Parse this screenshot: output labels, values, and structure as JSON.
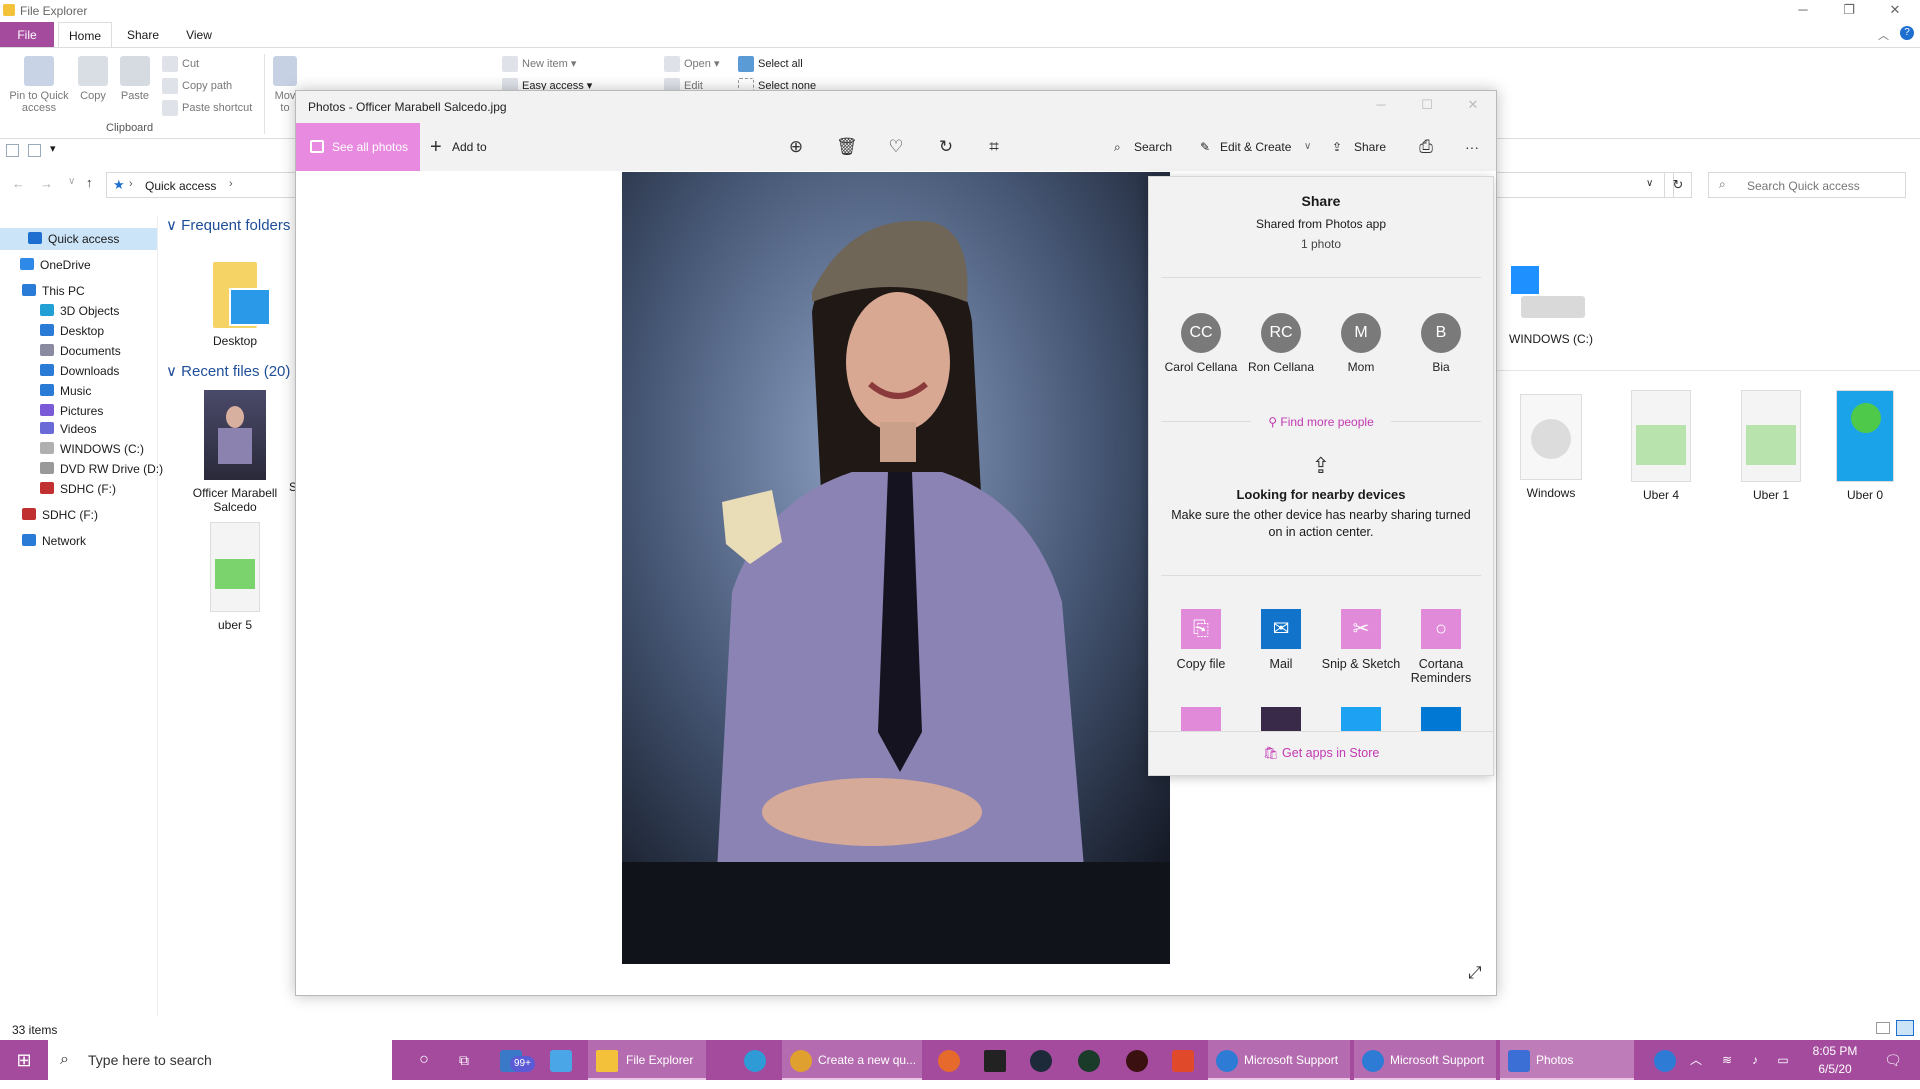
{
  "explorer": {
    "title": "File Explorer",
    "tabs": {
      "file": "File",
      "home": "Home",
      "share": "Share",
      "view": "View"
    },
    "ribbon": {
      "pin": "Pin to Quick access",
      "copy": "Copy",
      "paste": "Paste",
      "cut": "Cut",
      "copy_path": "Copy path",
      "paste_shortcut": "Paste shortcut",
      "clipboard_group": "Clipboard",
      "move_to": "Mov to",
      "new_item": "New item",
      "easy_access": "Easy access",
      "open": "Open",
      "edit": "Edit",
      "select_all": "Select all",
      "select_none": "Select none"
    },
    "address": {
      "path": "Quick access",
      "search_placeholder": "Search Quick access"
    },
    "nav": [
      {
        "label": "Quick access"
      },
      {
        "label": "OneDrive"
      },
      {
        "label": "This PC"
      },
      {
        "label": "3D Objects"
      },
      {
        "label": "Desktop"
      },
      {
        "label": "Documents"
      },
      {
        "label": "Downloads"
      },
      {
        "label": "Music"
      },
      {
        "label": "Pictures"
      },
      {
        "label": "Videos"
      },
      {
        "label": "WINDOWS (C:)"
      },
      {
        "label": "DVD RW Drive (D:)"
      },
      {
        "label": "SDHC (F:)"
      },
      {
        "label": "SDHC (F:)"
      },
      {
        "label": "Network"
      }
    ],
    "frequent_header": "Frequent folders (",
    "recent_header": "Recent files (20)",
    "files": {
      "desktop": "Desktop",
      "officer": "Officer Marabell Salcedo",
      "uber5": "uber 5",
      "windows_c": "WINDOWS (C:)",
      "windows": "Windows",
      "uber4": "Uber 4",
      "uber1": "Uber 1",
      "uber0": "Uber 0",
      "partial_s": "S"
    },
    "status": "33 items"
  },
  "photos": {
    "title": "Photos - Officer Marabell Salcedo.jpg",
    "see_all": "See all photos",
    "add_to": "Add to",
    "search": "Search",
    "edit_create": "Edit & Create",
    "share": "Share",
    "more": "···"
  },
  "share_panel": {
    "title": "Share",
    "subtitle": "Shared from Photos app",
    "count": "1 photo",
    "people": [
      {
        "initials": "CC",
        "name": "Carol Cellana"
      },
      {
        "initials": "RC",
        "name": "Ron Cellana"
      },
      {
        "initials": "M",
        "name": "Mom"
      },
      {
        "initials": "B",
        "name": "Bia"
      }
    ],
    "find_more": "Find more people",
    "nearby_title": "Looking for nearby devices",
    "nearby_text": "Make sure the other device has nearby sharing turned on in action center.",
    "apps": [
      {
        "name": "Copy file",
        "color": "#e08ad9"
      },
      {
        "name": "Mail",
        "color": "#1173c9"
      },
      {
        "name": "Snip & Sketch",
        "color": "#e08ad9"
      },
      {
        "name": "Cortana Reminders",
        "color": "#e08ad9"
      }
    ],
    "get_apps": "Get apps in Store"
  },
  "taskbar": {
    "search_placeholder": "Type here to search",
    "mail_badge": "99+",
    "items": {
      "file_explorer": "File Explorer",
      "chrome": "Create a new qu...",
      "ms_support_1": "Microsoft Support",
      "ms_support_2": "Microsoft Support",
      "photos": "Photos"
    },
    "time": "8:05 PM",
    "date": "6/5/20"
  },
  "colors": {
    "accent": "#e08ad9",
    "taskbar": "#a54b9e",
    "link_pink": "#c239b3"
  }
}
